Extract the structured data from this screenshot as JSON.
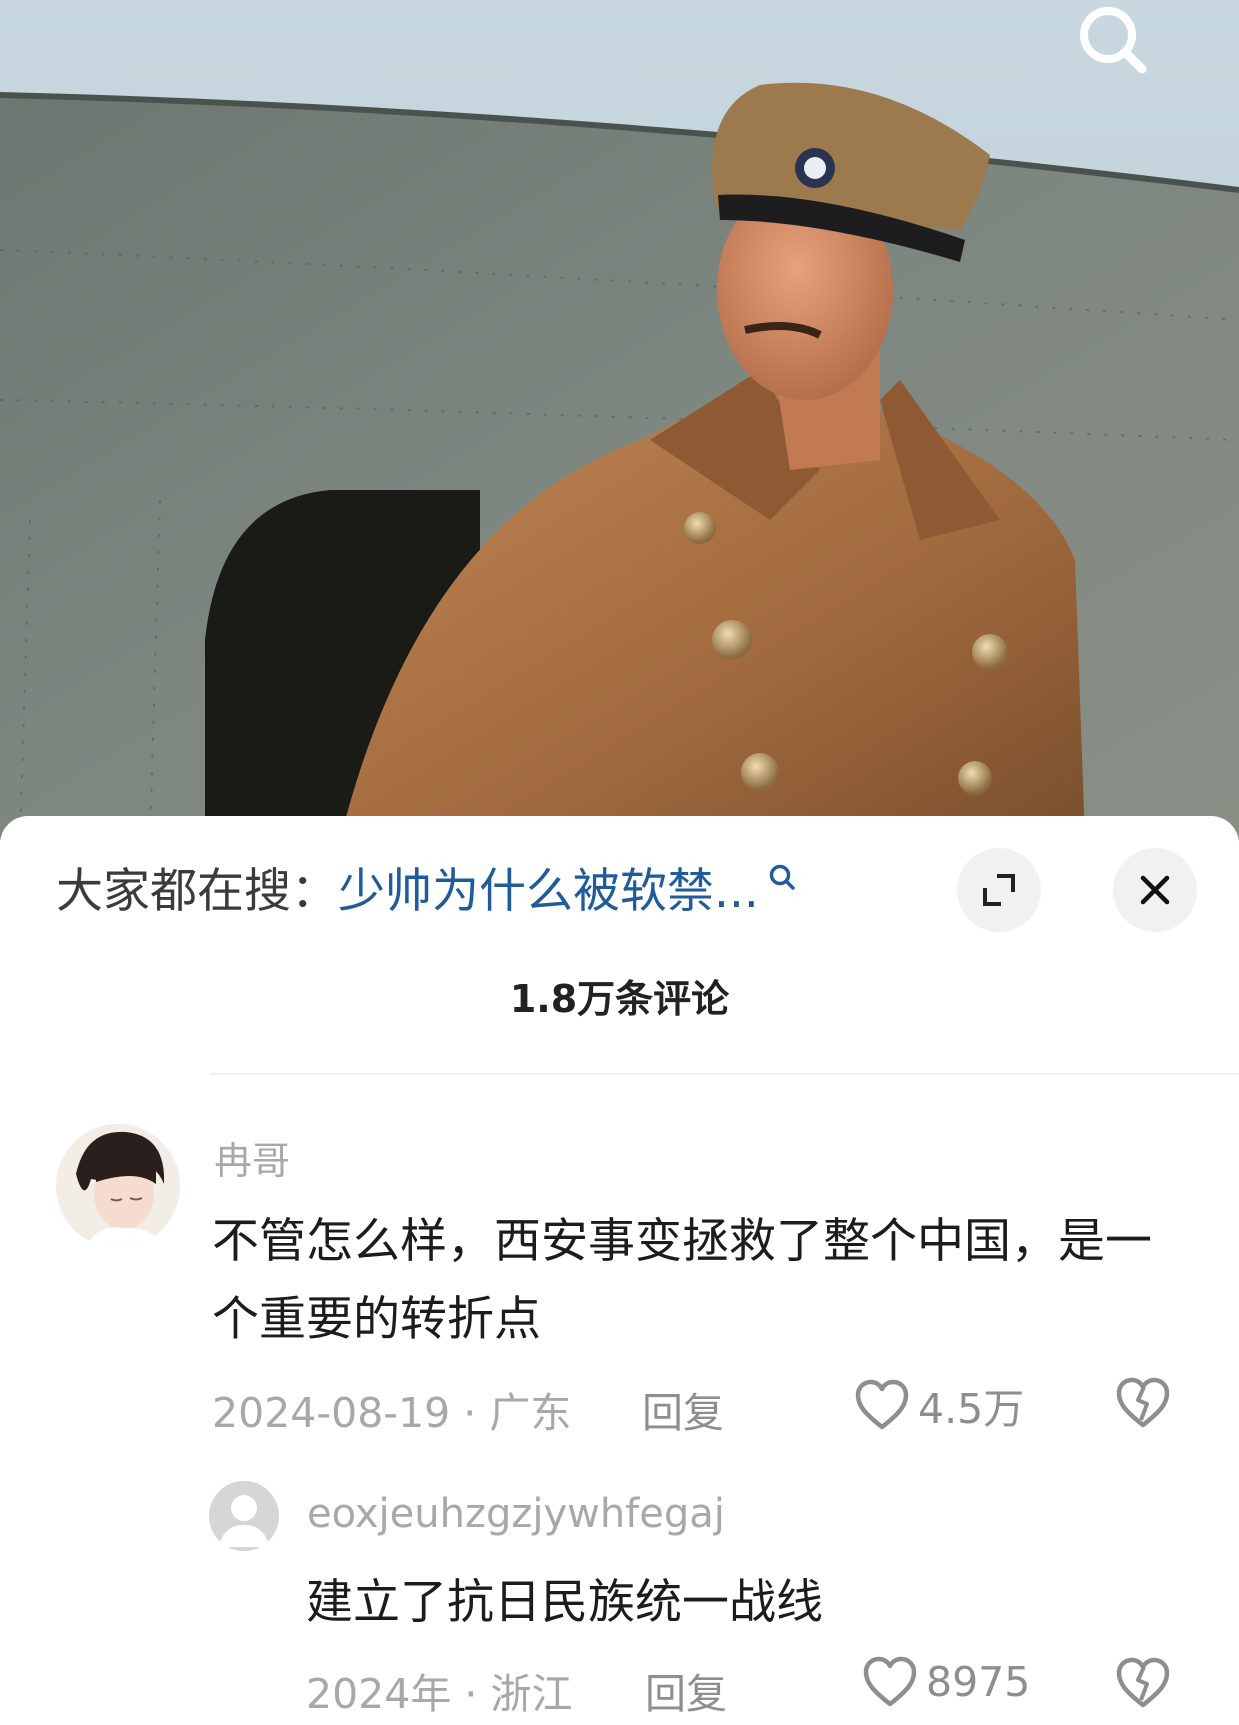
{
  "video": {
    "icons": [
      "search-icon"
    ]
  },
  "hot_search": {
    "prefix": "大家都在搜：",
    "query": "少帅为什么被软禁...",
    "icons": [
      "search-icon",
      "expand-icon",
      "close-icon"
    ]
  },
  "comments_header": {
    "count_label": "1.8万条评论"
  },
  "comments": [
    {
      "username": "冉哥",
      "text": "不管怎么样，西安事变拯救了整个中国，是一个重要的转折点",
      "date_location": "2024-08-19 · 广东",
      "reply_label": "回复",
      "likes": "4.5万",
      "replies": [
        {
          "username": "eoxjeuhzgzjywhfegaj",
          "text": "建立了抗日民族统一战线",
          "date_location": "2024年 · 浙江",
          "reply_label": "回复",
          "likes": "8975"
        }
      ]
    }
  ],
  "colors": {
    "query_blue": "#1f5c99",
    "meta_gray": "#a8a8a8",
    "text_dark": "#1c1c1c"
  }
}
